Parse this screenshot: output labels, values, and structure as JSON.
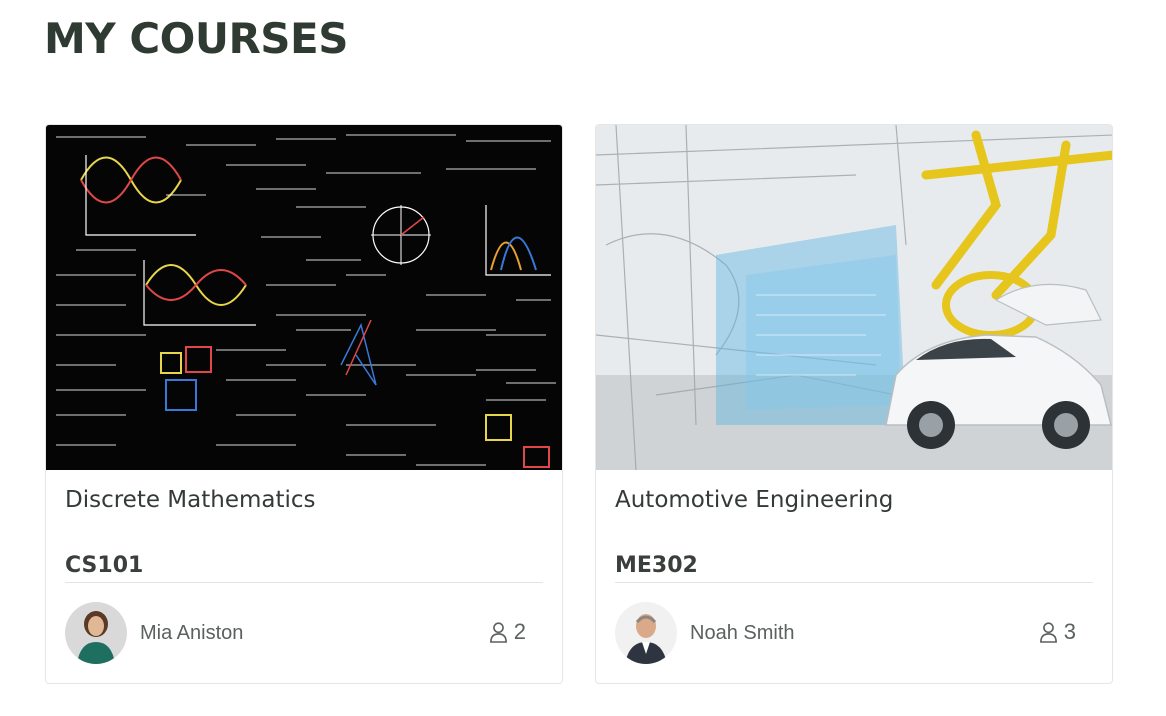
{
  "page": {
    "title": "MY COURSES"
  },
  "courses": [
    {
      "title": "Discrete Mathematics",
      "code": "CS101",
      "instructor": "Mia Aniston",
      "students": "2",
      "student_icon": "user-icon"
    },
    {
      "title": "Automotive Engineering",
      "code": "ME302",
      "instructor": "Noah Smith",
      "students": "3",
      "student_icon": "user-icon"
    }
  ],
  "colors": {
    "title": "#2f3a33",
    "text": "#5b615d",
    "card_border": "#e6e6e6",
    "chalkboard": "#050505",
    "factory_yellow": "#e6c51c",
    "hologram_blue": "#5fb3e0"
  }
}
